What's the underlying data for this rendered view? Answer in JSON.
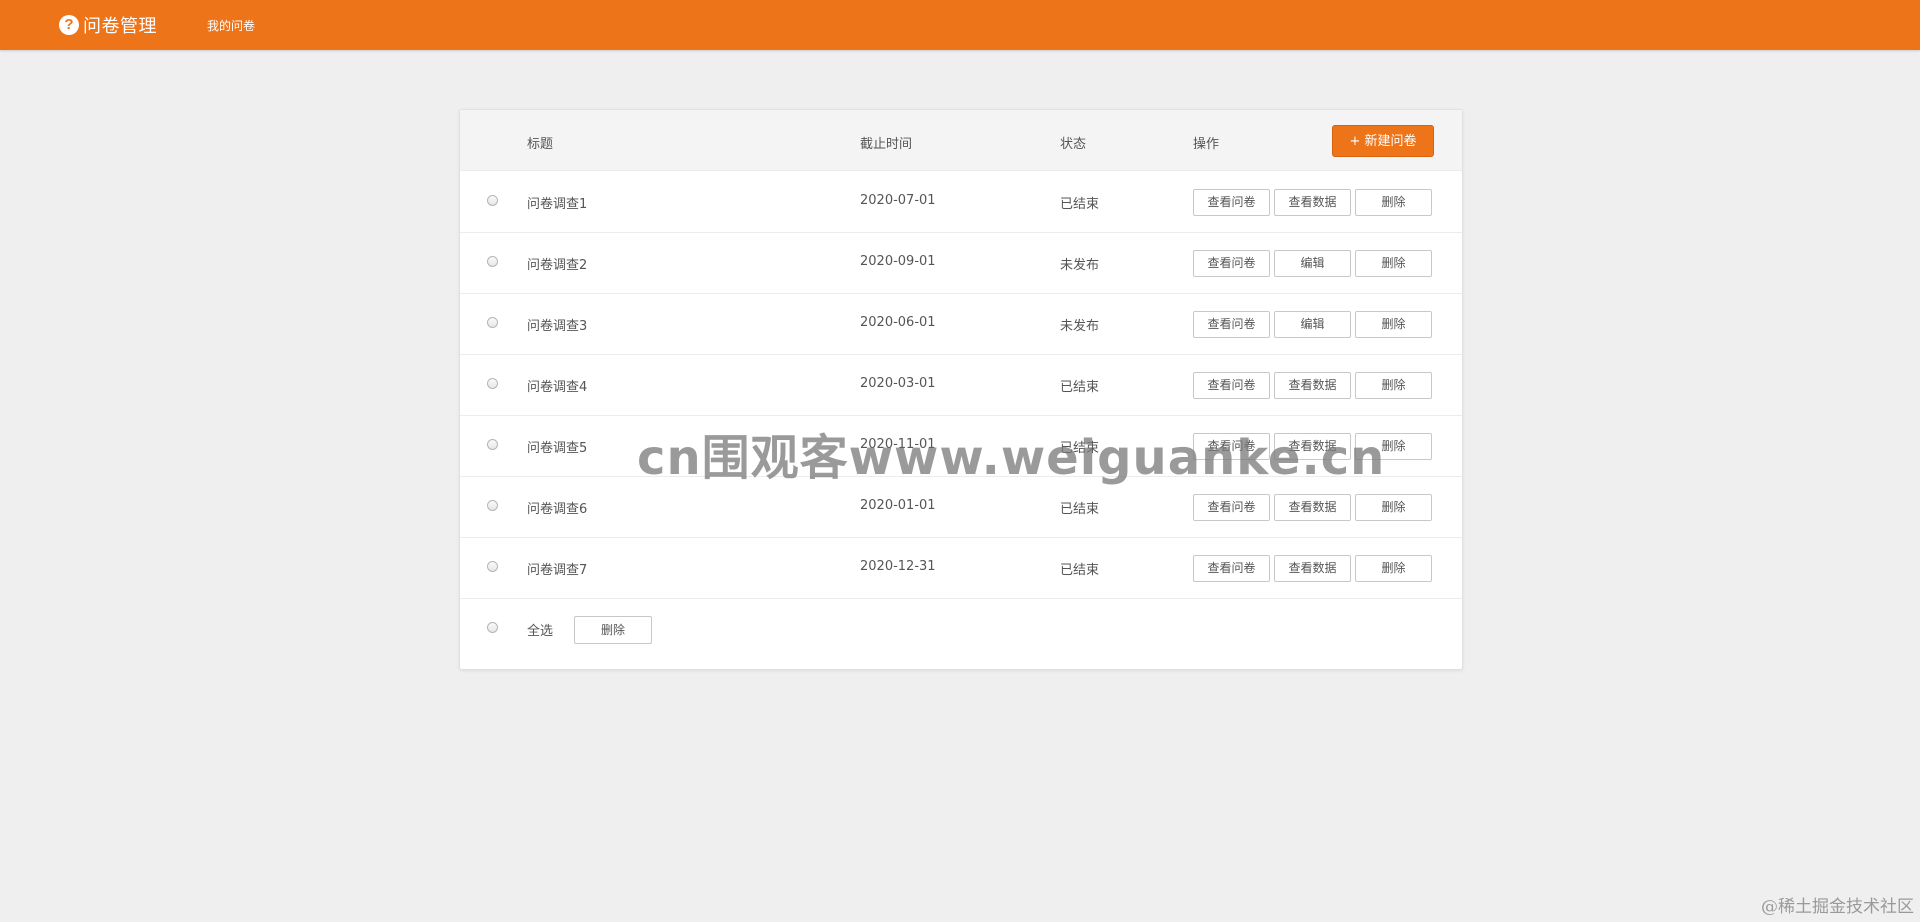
{
  "app": {
    "logo_icon": "question-circle-icon",
    "title": "问卷管理",
    "nav_link": "我的问卷"
  },
  "colors": {
    "brand": "#ee7419",
    "background": "#efefef"
  },
  "table": {
    "headers": {
      "title": "标题",
      "deadline": "截止时间",
      "status": "状态",
      "actions": "操作"
    },
    "new_button": "+ 新建问卷",
    "rows": [
      {
        "title": "问卷调查1",
        "deadline": "2020-07-01",
        "status": "已结束",
        "actions": [
          "查看问卷",
          "查看数据",
          "删除"
        ]
      },
      {
        "title": "问卷调查2",
        "deadline": "2020-09-01",
        "status": "未发布",
        "actions": [
          "查看问卷",
          "编辑",
          "删除"
        ]
      },
      {
        "title": "问卷调查3",
        "deadline": "2020-06-01",
        "status": "未发布",
        "actions": [
          "查看问卷",
          "编辑",
          "删除"
        ]
      },
      {
        "title": "问卷调查4",
        "deadline": "2020-03-01",
        "status": "已结束",
        "actions": [
          "查看问卷",
          "查看数据",
          "删除"
        ]
      },
      {
        "title": "问卷调查5",
        "deadline": "2020-11-01",
        "status": "已结束",
        "actions": [
          "查看问卷",
          "查看数据",
          "删除"
        ]
      },
      {
        "title": "问卷调查6",
        "deadline": "2020-01-01",
        "status": "已结束",
        "actions": [
          "查看问卷",
          "查看数据",
          "删除"
        ]
      },
      {
        "title": "问卷调查7",
        "deadline": "2020-12-31",
        "status": "已结束",
        "actions": [
          "查看问卷",
          "查看数据",
          "删除"
        ]
      }
    ],
    "footer": {
      "select_all": "全选",
      "delete": "删除"
    }
  },
  "watermark": "cn围观客www.weiguanke.cn",
  "corner_mark": "@稀土掘金技术社区"
}
